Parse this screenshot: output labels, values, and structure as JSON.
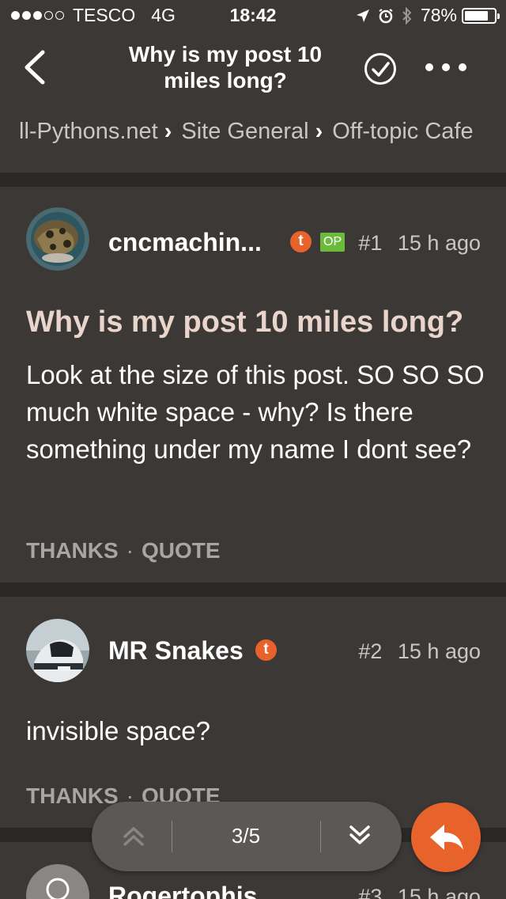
{
  "status_bar": {
    "carrier": "TESCO",
    "network": "4G",
    "time": "18:42",
    "battery": "78%",
    "signal_bars_filled": 3,
    "signal_bars_total": 5
  },
  "nav": {
    "title": "Why is my post 10 miles long?",
    "back_icon": "chevron-left-icon",
    "check_icon": "check-circle-icon",
    "more_icon": "more-horizontal-icon"
  },
  "breadcrumb": [
    {
      "label": "ll-Pythons.net"
    },
    {
      "label": "Site General"
    },
    {
      "label": "Off-topic Cafe"
    }
  ],
  "posts": [
    {
      "author": "cncmachin...",
      "badges": {
        "tapatalk": "t",
        "op": "OP"
      },
      "number": "#1",
      "time": "15 h ago",
      "title": "Why is my post 10 miles long?",
      "body": "Look at the size of this post. SO SO SO much white space - why? Is there something under my name I dont see?",
      "actions": {
        "thanks": "THANKS",
        "dot": "·",
        "quote": "QUOTE"
      }
    },
    {
      "author": "MR Snakes",
      "badges": {
        "tapatalk": "t"
      },
      "number": "#2",
      "time": "15 h ago",
      "body": "invisible space?",
      "actions": {
        "thanks": "THANKS",
        "dot": "·",
        "quote": "QUOTE"
      }
    },
    {
      "author": "Rogertophis",
      "number": "#3",
      "time": "15 h ago"
    }
  ],
  "pager": {
    "label": "3/5",
    "up_icon": "double-chevron-up-icon",
    "down_icon": "double-chevron-down-icon"
  },
  "reply_icon": "reply-icon",
  "colors": {
    "background": "#3b3836",
    "divider": "#2b2928",
    "accent": "#e8632b",
    "op_badge": "#6cba3c",
    "title_text": "#e9d5cc",
    "muted_text": "#a9a5a2"
  }
}
